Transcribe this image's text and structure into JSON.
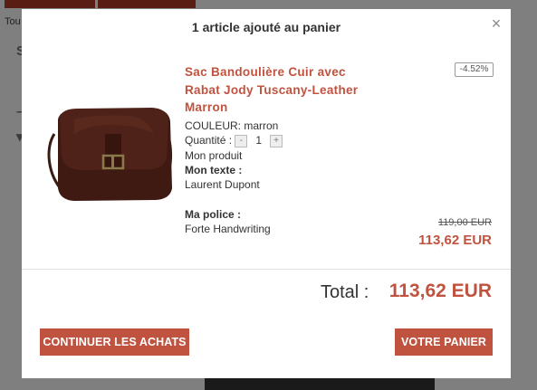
{
  "background": {
    "fragment_text": "Tou",
    "marks": [
      "S",
      "–",
      "▾"
    ]
  },
  "modal": {
    "title": "1 article ajouté au panier",
    "close_glyph": "×",
    "product": {
      "name": "Sac Bandoulière Cuir avec Rabat Jody Tuscany-Leather Marron",
      "discount": "-4.52%",
      "color_label": "COULEUR: marron",
      "quantity_label": "Quantité :",
      "quantity_minus": "-",
      "quantity_value": "1",
      "quantity_plus": "+",
      "custom_product": "Mon produit",
      "text_label": "Mon texte :",
      "text_value": "Laurent Dupont",
      "font_label": "Ma police :",
      "font_value": "Forte Handwriting",
      "old_price": "119,00 EUR",
      "new_price": "113,62 EUR"
    },
    "total_label": "Total :",
    "total_value": "113,62 EUR",
    "continue_button": "CONTINUER LES ACHATS",
    "cart_button": "VOTRE PANIER"
  },
  "colors": {
    "accent": "#c0533f",
    "overlay": "#7f7f7f"
  }
}
